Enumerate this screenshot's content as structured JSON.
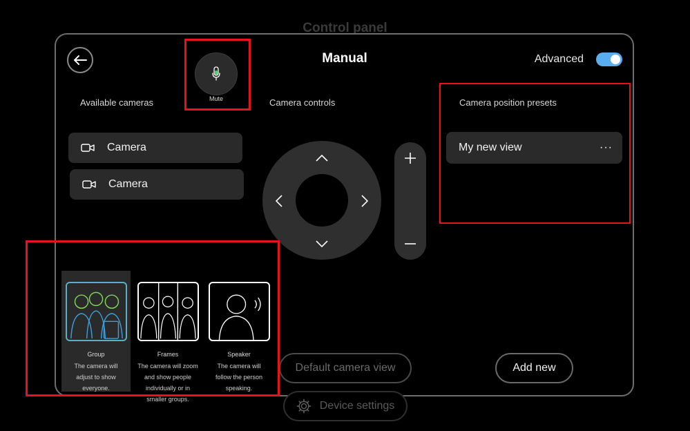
{
  "background_title": "Control panel",
  "header": {
    "title": "Manual",
    "advanced_label": "Advanced",
    "advanced_on": true
  },
  "mute": {
    "label": "Mute"
  },
  "sections": {
    "available_cameras": "Available cameras",
    "camera_controls": "Camera controls",
    "camera_presets": "Camera position presets"
  },
  "cameras": [
    {
      "label": "Camera"
    },
    {
      "label": "Camera"
    }
  ],
  "presets": [
    {
      "label": "My new view",
      "menu": "···"
    }
  ],
  "buttons": {
    "default_view": "Default camera view",
    "add_new": "Add new",
    "device_settings": "Device settings"
  },
  "modes": [
    {
      "name": "Group",
      "description": "The camera will adjust to show everyone.",
      "selected": true
    },
    {
      "name": "Frames",
      "description": "The camera will zoom and show people individually or in smaller groups.",
      "selected": false
    },
    {
      "name": "Speaker",
      "description": "The camera will follow the person speaking.",
      "selected": false
    }
  ],
  "colors": {
    "accent": "#5aaef0",
    "highlight": "#e8121d",
    "mic": "#4ad36a",
    "group_green": "#7ed957",
    "group_blue": "#3aa0e0"
  }
}
